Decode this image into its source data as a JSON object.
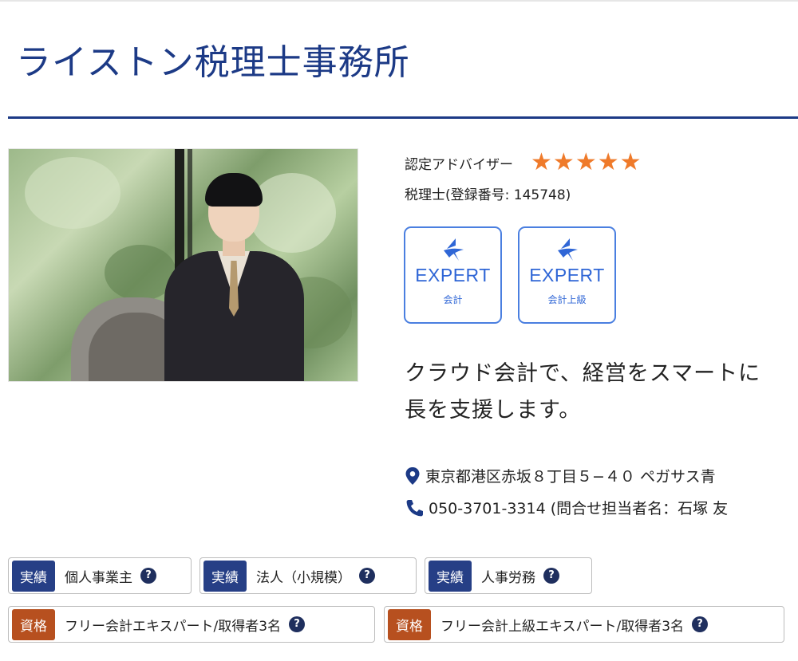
{
  "office": {
    "name": "ライストン税理士事務所"
  },
  "profile": {
    "adviser_label": "認定アドバイザー",
    "rating_stars": 5,
    "registration": "税理士(登録番号: 145748)"
  },
  "badges": [
    {
      "title": "EXPERT",
      "sub": "会計"
    },
    {
      "title": "EXPERT",
      "sub": "会計上級"
    }
  ],
  "tagline": {
    "line1": "クラウド会計で、経営をスマートに",
    "line2": "長を支援します。"
  },
  "contact": {
    "address": "東京都港区赤坂８丁目５−４０ ペガサス青",
    "phone": "050-3701-3314 (問合せ担当者名：石塚 友"
  },
  "tags": [
    {
      "kind": "実績",
      "text": "個人事業主",
      "help": "?"
    },
    {
      "kind": "実績",
      "text": "法人（小規模）",
      "help": "?"
    },
    {
      "kind": "実績",
      "text": "人事労務",
      "help": "?"
    },
    {
      "kind": "資格",
      "text": "フリー会計エキスパート/取得者3名",
      "help": "?"
    },
    {
      "kind": "資格",
      "text": "フリー会計上級エキスパート/取得者3名",
      "help": "?"
    }
  ],
  "colors": {
    "brand": "#1c3a86",
    "star": "#ef7a2a",
    "badge": "#2f66d6",
    "tag_blue": "#263f86",
    "tag_orange": "#b7501f"
  },
  "icons": {
    "address": "map-pin-icon",
    "phone": "phone-icon",
    "help": "question-circle-icon",
    "badge": "freee-bird-icon"
  }
}
